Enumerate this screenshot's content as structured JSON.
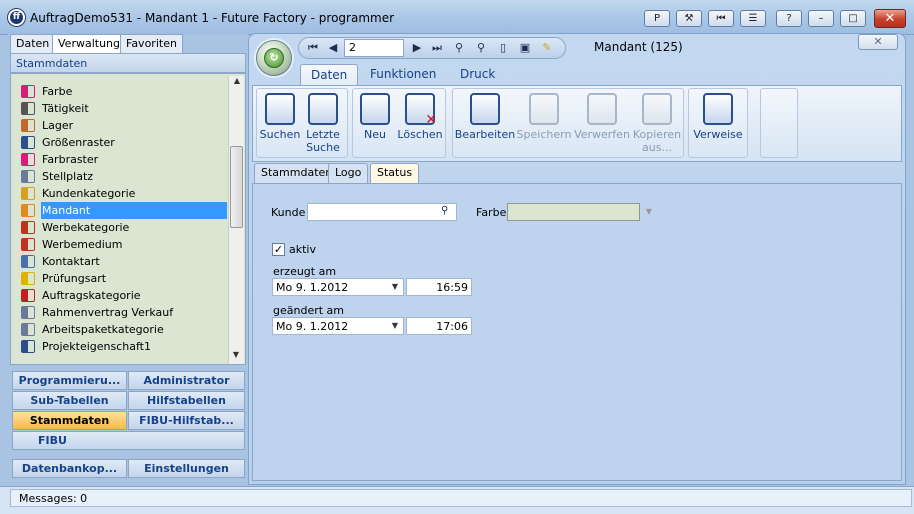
{
  "app": {
    "title": "AuftragDemo531 - Mandant 1 - Future Factory - programmer",
    "icon_letter": "ff"
  },
  "titlebar_buttons": [
    {
      "name": "help-p",
      "glyph": "P"
    },
    {
      "name": "wrench",
      "glyph": "⚒"
    },
    {
      "name": "back-pipe",
      "glyph": "⏮"
    },
    {
      "name": "network",
      "glyph": "☰"
    },
    {
      "name": "help",
      "glyph": "?"
    },
    {
      "name": "minimize",
      "glyph": "–"
    },
    {
      "name": "maximize",
      "glyph": "□"
    }
  ],
  "close_glyph": "✕",
  "nav_tabs": [
    "Daten",
    "Verwaltung",
    "Favoriten"
  ],
  "nav_active_tab": "Verwaltung",
  "stammdaten_header": "Stammdaten",
  "tree_items": [
    {
      "label": "Farbe",
      "icon": "color-bars-icon",
      "color": "#d81c7a"
    },
    {
      "label": "Tätigkeit",
      "icon": "hammer-icon",
      "color": "#555555"
    },
    {
      "label": "Lager",
      "icon": "worker-icon",
      "color": "#c0692a"
    },
    {
      "label": "Größenraster",
      "icon": "ruler-icon",
      "color": "#2b4e8c"
    },
    {
      "label": "Farbraster",
      "icon": "color-bars-icon",
      "color": "#d81c7a"
    },
    {
      "label": "Stellplatz",
      "icon": "grid-icon",
      "color": "#6a7a9a"
    },
    {
      "label": "Kundenkategorie",
      "icon": "people-icon",
      "color": "#d8a020"
    },
    {
      "label": "Mandant",
      "icon": "folder-icon",
      "color": "#e08a1c"
    },
    {
      "label": "Werbekategorie",
      "icon": "megaphone-icon",
      "color": "#c23020"
    },
    {
      "label": "Werbemedium",
      "icon": "megaphone-icon",
      "color": "#c23020"
    },
    {
      "label": "Kontaktart",
      "icon": "phone-icon",
      "color": "#4a6fb0"
    },
    {
      "label": "Prüfungsart",
      "icon": "warning-icon",
      "color": "#e2b000"
    },
    {
      "label": "Auftragskategorie",
      "icon": "checklist-icon",
      "color": "#c02020"
    },
    {
      "label": "Rahmenvertrag Verkauf",
      "icon": "document-icon",
      "color": "#6a7a9a"
    },
    {
      "label": "Arbeitspaketkategorie",
      "icon": "list-icon",
      "color": "#6a7a9a"
    },
    {
      "label": "Projekteigenschaft1",
      "icon": "edit-chart-icon",
      "color": "#2b4e8c"
    }
  ],
  "tree_selected": "Mandant",
  "outlook_buttons": [
    [
      "Programmieru...",
      "Administrator"
    ],
    [
      "Sub-Tabellen",
      "Hilfstabellen"
    ],
    [
      "Stammdaten",
      "FIBU-Hilfstab..."
    ],
    [
      "FIBU"
    ],
    [
      "Datenbankop...",
      "Einstellungen"
    ]
  ],
  "outlook_active": "Stammdaten",
  "status_message": "Messages: 0",
  "child": {
    "record_number": "2",
    "title": "Mandant  (125)",
    "ribbon_tabs": [
      "Daten",
      "Funktionen",
      "Druck"
    ],
    "ribbon_active": "Daten",
    "ribbon_buttons": [
      {
        "label": "Suchen",
        "icon": "binoculars-icon",
        "enabled": true
      },
      {
        "label": "Letzte\nSuche",
        "icon": "binoculars-recent-icon",
        "enabled": true
      },
      {
        "label": "Neu",
        "icon": "new-document-icon",
        "enabled": true
      },
      {
        "label": "Löschen",
        "icon": "delete-document-icon",
        "enabled": true
      },
      {
        "label": "Bearbeiten",
        "icon": "edit-icon",
        "enabled": true
      },
      {
        "label": "Speichern",
        "icon": "save-icon",
        "enabled": false
      },
      {
        "label": "Verwerfen",
        "icon": "undo-icon",
        "enabled": false
      },
      {
        "label": "Kopieren\naus...",
        "icon": "copy-icon",
        "enabled": false
      },
      {
        "label": "Verweise",
        "icon": "link-icon",
        "enabled": true
      }
    ],
    "inner_tabs": [
      "Stammdaten",
      "Logo",
      "Status"
    ],
    "inner_active": "Status",
    "form": {
      "kunde_label": "Kunde",
      "kunde_value": "",
      "farbe_label": "Farbe",
      "farbe_value": "",
      "aktiv_label": "aktiv",
      "aktiv_checked": true,
      "erzeugt_label": "erzeugt am",
      "erzeugt_date": "Mo   9. 1.2012",
      "erzeugt_time": "16:59",
      "geaendert_label": "geändert am",
      "geaendert_date": "Mo   9. 1.2012",
      "geaendert_time": "17:06"
    }
  },
  "colors": {
    "accent": "#15428b",
    "selection": "#3399ff",
    "active_orange": "#f7b94c",
    "close_red": "#c8412b"
  }
}
